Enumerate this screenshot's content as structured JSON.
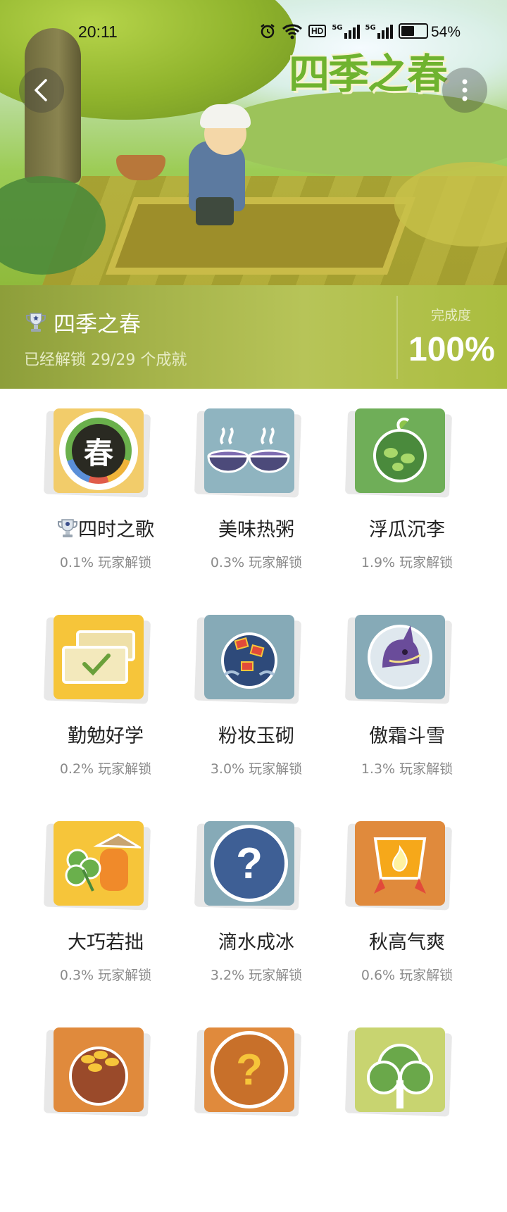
{
  "status_bar": {
    "time": "20:11",
    "battery": "54%",
    "hd": "HD",
    "net1": "5G",
    "net2": "5G"
  },
  "hero": {
    "logo_text": "四季之春"
  },
  "summary": {
    "title": "四季之春",
    "subtitle": "已经解锁 29/29 个成就",
    "completion_label": "完成度",
    "completion_value": "100%"
  },
  "achievements": [
    {
      "name": "四时之歌",
      "rate": "0.1% 玩家解锁",
      "icon": "spring-wreath-icon",
      "bg": "#f2cc6a",
      "glyph": "春",
      "trophy": true
    },
    {
      "name": "美味热粥",
      "rate": "0.3% 玩家解锁",
      "icon": "hot-porridge-bowls-icon",
      "bg": "#8fb4c0",
      "glyph": ""
    },
    {
      "name": "浮瓜沉李",
      "rate": "1.9% 玩家解锁",
      "icon": "green-melon-icon",
      "bg": "#6fae58",
      "glyph": ""
    },
    {
      "name": "勤勉好学",
      "rate": "0.2% 玩家解锁",
      "icon": "checklist-icon",
      "bg": "#f6c53a",
      "glyph": "✓"
    },
    {
      "name": "粉妆玉砌",
      "rate": "3.0% 玩家解锁",
      "icon": "snow-ornament-icon",
      "bg": "#86aab7",
      "glyph": ""
    },
    {
      "name": "傲霜斗雪",
      "rate": "1.3% 玩家解锁",
      "icon": "purple-beast-icon",
      "bg": "#86aab7",
      "glyph": ""
    },
    {
      "name": "大巧若拙",
      "rate": "0.3% 玩家解锁",
      "icon": "clover-farmer-icon",
      "bg": "#f6c53a",
      "glyph": ""
    },
    {
      "name": "滴水成冰",
      "rate": "3.2% 玩家解锁",
      "icon": "hidden-question-icon",
      "bg": "#86aab7",
      "glyph": "?"
    },
    {
      "name": "秋高气爽",
      "rate": "0.6% 玩家解锁",
      "icon": "flame-cup-icon",
      "bg": "#e08a3c",
      "glyph": ""
    },
    {
      "name": "",
      "rate": "",
      "icon": "harvest-basket-icon",
      "bg": "#e08a3c",
      "glyph": ""
    },
    {
      "name": "",
      "rate": "",
      "icon": "hidden-question-icon",
      "bg": "#e08a3c",
      "glyph": "?"
    },
    {
      "name": "",
      "rate": "",
      "icon": "green-tree-icon",
      "bg": "#c8d470",
      "glyph": ""
    }
  ]
}
